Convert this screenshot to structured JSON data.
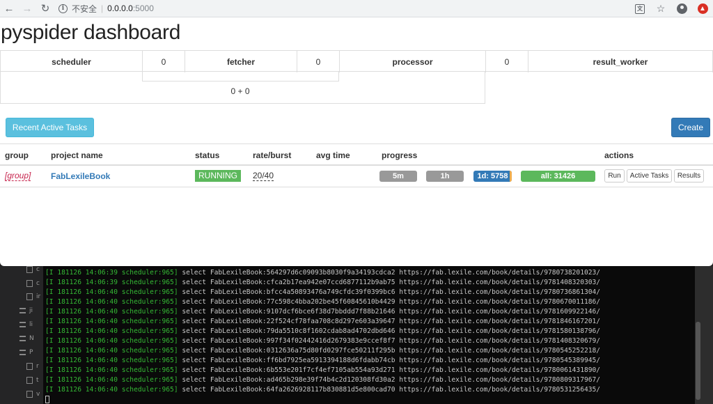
{
  "browser": {
    "insecure_label": "不安全",
    "separator": "|",
    "host": "0.0.0.0",
    "port": ":5000"
  },
  "page": {
    "title": "pyspider dashboard"
  },
  "queues": {
    "items": [
      {
        "name": "scheduler",
        "count": "0"
      },
      {
        "name": "fetcher",
        "count": "0"
      },
      {
        "name": "processor",
        "count": "0"
      },
      {
        "name": "result_worker",
        "count": ""
      }
    ],
    "summary": "0 + 0"
  },
  "buttons": {
    "recent": "Recent Active Tasks",
    "create": "Create"
  },
  "projects": {
    "headers": {
      "group": "group",
      "name": "project name",
      "status": "status",
      "rate": "rate/burst",
      "avg": "avg time",
      "progress": "progress",
      "actions": "actions"
    },
    "rows": [
      {
        "group": "[group]",
        "name": "FabLexileBook",
        "status": "RUNNING",
        "rate": "20/40",
        "progress": {
          "p5m": "5m",
          "p1h": "1h",
          "p1d": "1d: 5758",
          "all": "all: 31426"
        },
        "actions": {
          "run": "Run",
          "active": "Active Tasks",
          "results": "Results"
        }
      }
    ]
  },
  "colors": {
    "status_running": "#5cb85c",
    "progress_blue": "#337ab7",
    "progress_green": "#5cb85c",
    "progress_gray": "#999999",
    "log_green": "#35b935"
  },
  "terminal": {
    "tree_labels": [
      "c",
      "c",
      "ir",
      "ji",
      "li",
      "N",
      "P",
      "r",
      "t",
      "v"
    ],
    "lines": [
      {
        "prefix": "[I 181126 14:06:39 scheduler:965]",
        "msg": "select FabLexileBook:564297d6c09093b8030f9a34193cdca2 https://fab.lexile.com/book/details/9780738201023/"
      },
      {
        "prefix": "[I 181126 14:06:39 scheduler:965]",
        "msg": "select FabLexileBook:cfca2b17ea942e07ccd6877112b9ab75 https://fab.lexile.com/book/details/9781408320303/"
      },
      {
        "prefix": "[I 181126 14:06:40 scheduler:965]",
        "msg": "select FabLexileBook:bfcc4a50893476a749cfdc39f0399bc6 https://fab.lexile.com/book/details/9780736861304/"
      },
      {
        "prefix": "[I 181126 14:06:40 scheduler:965]",
        "msg": "select FabLexileBook:77c598c4bba202be45f60845610b4429 https://fab.lexile.com/book/details/9780670011186/"
      },
      {
        "prefix": "[I 181126 14:06:40 scheduler:965]",
        "msg": "select FabLexileBook:9107dcf6bce6f38d7bbddd7f88b21646 https://fab.lexile.com/book/details/9781609922146/"
      },
      {
        "prefix": "[I 181126 14:06:40 scheduler:965]",
        "msg": "select FabLexileBook:22f524cf78faa708c8d297e603a39647 https://fab.lexile.com/book/details/9781846167201/"
      },
      {
        "prefix": "[I 181126 14:06:40 scheduler:965]",
        "msg": "select FabLexileBook:79da5510c8f1602cdab8ad4702dbd646 https://fab.lexile.com/book/details/9781580138796/"
      },
      {
        "prefix": "[I 181126 14:06:40 scheduler:965]",
        "msg": "select FabLexileBook:997f34f02442416d2679383e9ccef8f7 https://fab.lexile.com/book/details/9781408320679/"
      },
      {
        "prefix": "[I 181126 14:06:40 scheduler:965]",
        "msg": "select FabLexileBook:0312636a75d80fd0297fce50211f295b https://fab.lexile.com/book/details/9780545252218/"
      },
      {
        "prefix": "[I 181126 14:06:40 scheduler:965]",
        "msg": "select FabLexileBook:ff6bd7925ea5913394188d6fdabb74cb https://fab.lexile.com/book/details/9780545389945/"
      },
      {
        "prefix": "[I 181126 14:06:40 scheduler:965]",
        "msg": "select FabLexileBook:6b553e201f7cf4ef7105ab554a93d271 https://fab.lexile.com/book/details/9780061431890/"
      },
      {
        "prefix": "[I 181126 14:06:40 scheduler:965]",
        "msg": "select FabLexileBook:ad465b298e39f74b4c2d120308fd30a2 https://fab.lexile.com/book/details/9780809317967/"
      },
      {
        "prefix": "[I 181126 14:06:40 scheduler:965]",
        "msg": "select FabLexileBook:64fa2626928117b830881d5e800cad70 https://fab.lexile.com/book/details/9780531256435/"
      }
    ]
  }
}
